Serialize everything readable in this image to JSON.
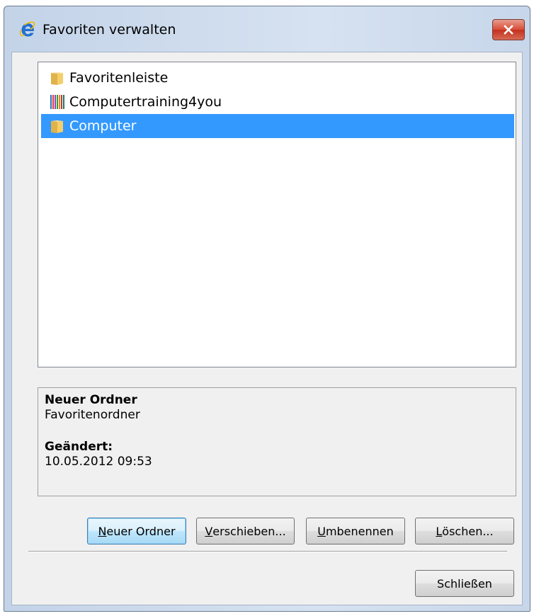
{
  "window": {
    "title": "Favoriten verwalten",
    "icon": "internet-explorer-icon"
  },
  "list": {
    "items": [
      {
        "label": "Favoritenleiste",
        "icon": "folder-icon",
        "selected": false
      },
      {
        "label": "Computertraining4you",
        "icon": "favorite-site-icon",
        "selected": false
      },
      {
        "label": "Computer",
        "icon": "folder-icon",
        "selected": true
      }
    ]
  },
  "details": {
    "name": "Neuer Ordner",
    "type": "Favoritenordner",
    "modified_label": "Geändert:",
    "modified_value": "10.05.2012 09:53"
  },
  "buttons": {
    "new_folder": {
      "accesskey": "N",
      "rest": "euer Ordner"
    },
    "move": {
      "accesskey": "V",
      "rest": "erschieben..."
    },
    "rename": {
      "accesskey": "U",
      "rest": "mbenennen"
    },
    "delete": {
      "accesskey": "L",
      "rest": "öschen..."
    },
    "close": "Schließen"
  },
  "colors": {
    "selection": "#3399ff",
    "close_button": "#c4321f",
    "window_frame": "#c3d3e8",
    "client_background": "#f0f0f0"
  }
}
